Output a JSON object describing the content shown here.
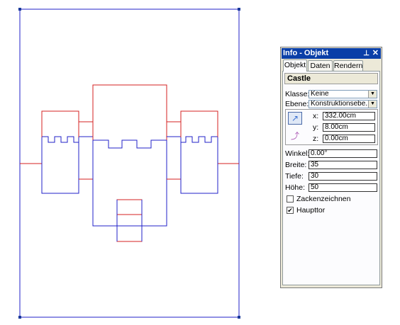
{
  "palette": {
    "title": "Info - Objekt",
    "pin_icon": "pin-icon",
    "close_icon": "close-icon",
    "tabs": [
      "Objekt",
      "Daten",
      "Rendern"
    ],
    "active_tab": "Objekt",
    "object_name": "Castle",
    "klasse_label": "Klasse:",
    "klasse_value": "Keine",
    "ebene_label": "Ebene:",
    "ebene_value": "Konstruktionsebe...",
    "x_label": "x:",
    "x_value": "332.00cm",
    "y_label": "y:",
    "y_value": "8.00cm",
    "z_label": "z:",
    "z_value": "0.00cm",
    "winkel_label": "Winkel:",
    "winkel_value": "0.00°",
    "breite_label": "Breite:",
    "breite_value": "35",
    "tiefe_label": "Tiefe:",
    "tiefe_value": "30",
    "hoehe_label": "Höhe:",
    "hoehe_value": "50",
    "zacken_label": "Zackenzeichnen",
    "zacken_checked": false,
    "haupttor_label": "Haupttor",
    "haupttor_checked": true
  },
  "colors": {
    "line_blue": "#2020c8",
    "line_red": "#d42020",
    "handle": "#1a3a9a",
    "title_bar": "#0a3fa8"
  }
}
